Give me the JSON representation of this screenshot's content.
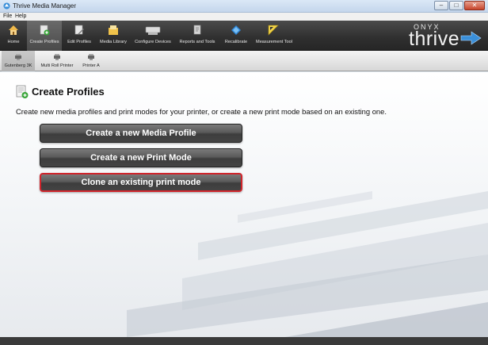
{
  "window": {
    "title": "Thrive Media Manager"
  },
  "menu": [
    "File",
    "Help"
  ],
  "toolbar": {
    "items": [
      {
        "label": "Home",
        "icon": "home-icon"
      },
      {
        "label": "Create Profiles",
        "icon": "create-profiles-icon"
      },
      {
        "label": "Edit Profiles",
        "icon": "edit-profiles-icon"
      },
      {
        "label": "Media Library",
        "icon": "media-library-icon"
      },
      {
        "label": "Configure Devices",
        "icon": "configure-devices-icon"
      },
      {
        "label": "Reports and Tools",
        "icon": "reports-tools-icon"
      },
      {
        "label": "Recalibrate",
        "icon": "recalibrate-icon"
      },
      {
        "label": "Measurement Tool",
        "icon": "measurement-tool-icon"
      }
    ],
    "active": "Create Profiles"
  },
  "brand": {
    "top": "ONYX",
    "name": "thrive"
  },
  "printers": [
    {
      "label": "Gutenberg 3K",
      "icon": "printer-icon"
    },
    {
      "label": "Multi Roll Printer",
      "icon": "printer-icon"
    },
    {
      "label": "Printer A",
      "icon": "printer-icon"
    }
  ],
  "page": {
    "title": "Create Profiles",
    "description": "Create new media profiles and print modes for your printer, or create a new print mode based on an existing one."
  },
  "actions": [
    {
      "label": "Create a new Media Profile"
    },
    {
      "label": "Create a new Print Mode"
    },
    {
      "label": "Clone an existing print mode"
    }
  ],
  "colors": {
    "accent": "#3a8fd9",
    "selection": "#d0242b",
    "toolbar": "#333333"
  }
}
